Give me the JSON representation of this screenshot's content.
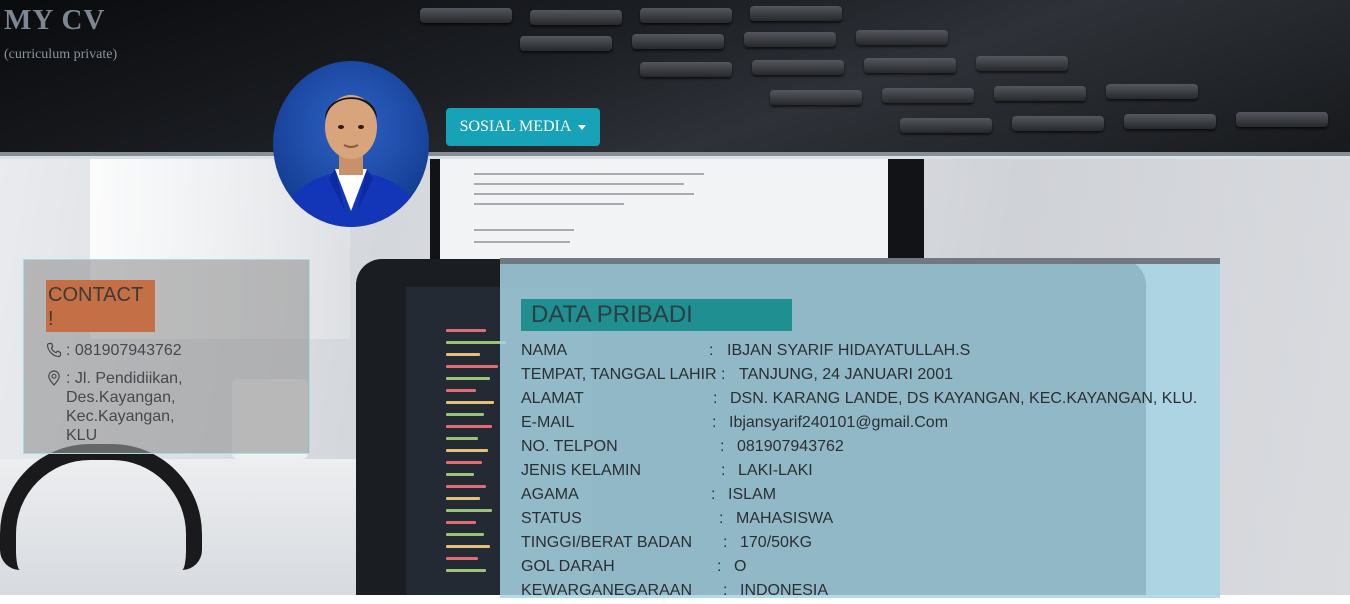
{
  "header": {
    "title": "MY CV",
    "subtitle": "(curriculum private)",
    "social_button": "SOSIAL MEDIA"
  },
  "contact": {
    "title": "CONTACT !",
    "phone": ": 081907943762",
    "address": ": Jl. Pendidiikan, Des.Kayangan, Kec.Kayangan, KLU"
  },
  "personal": {
    "title": "DATA PRIBADI",
    "rows": [
      {
        "label": "NAMA",
        "value": "IBJAN SYARIF HIDAYATULLAH.S"
      },
      {
        "label": "TEMPAT, TANGGAL LAHIR",
        "value": "TANJUNG, 24 JANUARI 2001"
      },
      {
        "label": "ALAMAT",
        "value": "DSN. KARANG LANDE, DS KAYANGAN, KEC.KAYANGAN, KLU."
      },
      {
        "label": "E-MAIL",
        "value": "Ibjansyarif240101@gmail.Com"
      },
      {
        "label": "NO. TELPON",
        "value": "081907943762"
      },
      {
        "label": "JENIS KELAMIN",
        "value": "LAKI-LAKI"
      },
      {
        "label": "AGAMA",
        "value": "ISLAM"
      },
      {
        "label": "STATUS",
        "value": "MAHASISWA"
      },
      {
        "label": "TINGGI/BERAT BADAN",
        "value": "170/50KG"
      },
      {
        "label": "GOL DARAH",
        "value": "O"
      },
      {
        "label": "KEWARGANEGARAAN",
        "value": "INDONESIA"
      }
    ]
  },
  "icons": {
    "phone": "phone-icon",
    "location": "map-pin-icon",
    "dropdown": "caret-down-icon"
  },
  "colors": {
    "button": "#17a2b8",
    "contact_heading": "#c46f46",
    "data_heading": "#1f8f8f",
    "data_card": "#a6d3e3"
  }
}
